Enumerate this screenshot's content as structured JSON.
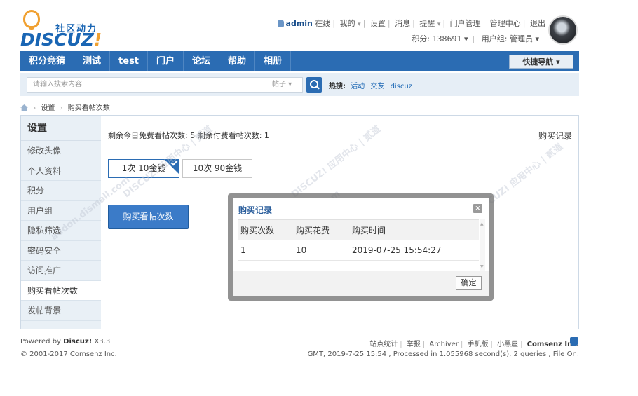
{
  "logo": {
    "cn": "社区动力",
    "en": "DISCUZ",
    "en_bang": "!"
  },
  "userbar": {
    "username": "admin",
    "online": "在线",
    "links": [
      "我的",
      "设置",
      "消息",
      "提醒",
      "门户管理",
      "管理中心",
      "退出"
    ],
    "credits": "积分: 138691",
    "usergroup": "用户组: 管理员"
  },
  "nav": {
    "items": [
      "积分竞猜",
      "测试",
      "test",
      "门户",
      "论坛",
      "帮助",
      "相册"
    ],
    "quicknav": "快捷导航 ▾"
  },
  "search": {
    "placeholder": "请输入搜索内容",
    "type": "帖子 ▾",
    "hot_label": "热搜:",
    "hot_words": [
      "活动",
      "交友",
      "discuz"
    ]
  },
  "breadcrumb": {
    "items": [
      "设置",
      "购买看帖次数"
    ]
  },
  "sidebar": {
    "title": "设置",
    "items": [
      "修改头像",
      "个人资料",
      "积分",
      "用户组",
      "隐私筛选",
      "密码安全",
      "访问推广",
      "购买看帖次数",
      "发帖背景"
    ]
  },
  "main": {
    "remain_text": "剩余今日免费看帖次数: 5  剩余付费看帖次数: 1",
    "buy_record_link": "购买记录",
    "options": [
      "1次 10金钱",
      "10次 90金钱"
    ],
    "buy_button": "购买看帖次数"
  },
  "modal": {
    "title": "购买记录",
    "columns": [
      "购买次数",
      "购买花费",
      "购买时间"
    ],
    "rows": [
      [
        "1",
        "10",
        "2019-07-25 15:54:27"
      ]
    ],
    "ok_button": "确定",
    "close_symbol": "×"
  },
  "footer": {
    "powered_prefix": "Powered by",
    "powered_name": "Discuz!",
    "powered_version": "X3.3",
    "copyright": "© 2001-2017 Comsenz Inc.",
    "links": [
      "站点统计",
      "举报",
      "Archiver",
      "手机版",
      "小黑屋"
    ],
    "company": "Comsenz Inc.",
    "stats": "GMT, 2019-7-25 15:54 , Processed in 1.055968 second(s), 2 queries , File On."
  },
  "colors": {
    "brand_blue": "#2b6cb3",
    "logo_orange": "#f0a030"
  }
}
